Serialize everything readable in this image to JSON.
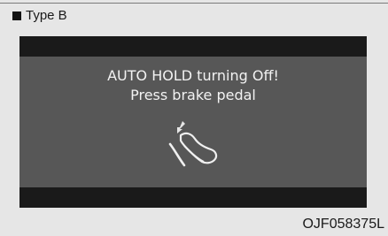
{
  "header_marker": "S",
  "section_label": "Type B",
  "display": {
    "line1": "AUTO HOLD turning Off!",
    "line2": "Press brake pedal",
    "icon": "brake-pedal-icon"
  },
  "figure_code": "OJF058375L"
}
